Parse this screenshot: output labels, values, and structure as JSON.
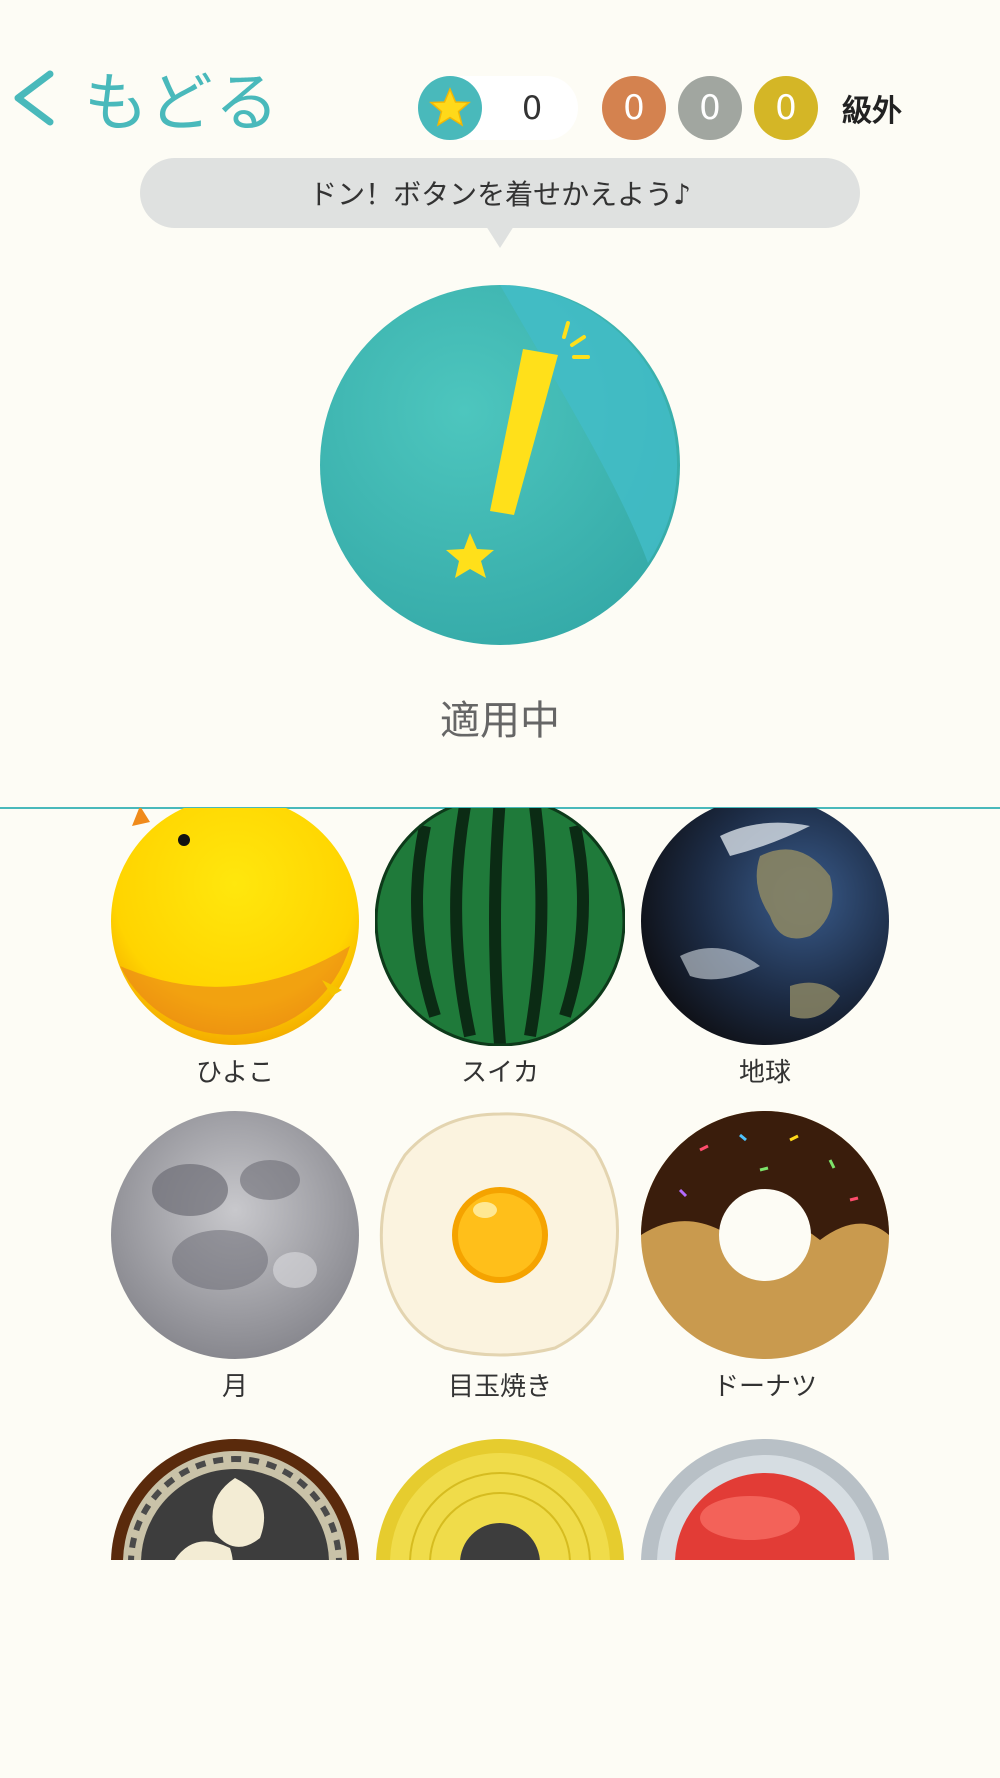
{
  "header": {
    "back_label": "もどる",
    "star_count": "0",
    "medals": {
      "bronze": "0",
      "silver": "0",
      "gold": "0"
    },
    "rank_label": "級外",
    "colors": {
      "accent": "#49b9bb",
      "bronze": "#d4824f",
      "silver": "#a1a6a0",
      "gold": "#d4b626"
    }
  },
  "bubble": {
    "text": "ドン！ボタンを着せかえよう♪"
  },
  "current": {
    "icon": "exclamation-star-icon",
    "status_label": "適用中"
  },
  "skins": [
    {
      "label": "ひよこ",
      "icon": "chick-icon"
    },
    {
      "label": "スイカ",
      "icon": "watermelon-icon"
    },
    {
      "label": "地球",
      "icon": "earth-icon"
    },
    {
      "label": "月",
      "icon": "moon-icon"
    },
    {
      "label": "目玉焼き",
      "icon": "fried-egg-icon"
    },
    {
      "label": "ドーナツ",
      "icon": "donut-icon"
    },
    {
      "label": "",
      "icon": "taiko-drum-icon"
    },
    {
      "label": "",
      "icon": "yellow-record-icon"
    },
    {
      "label": "",
      "icon": "red-button-icon"
    }
  ]
}
